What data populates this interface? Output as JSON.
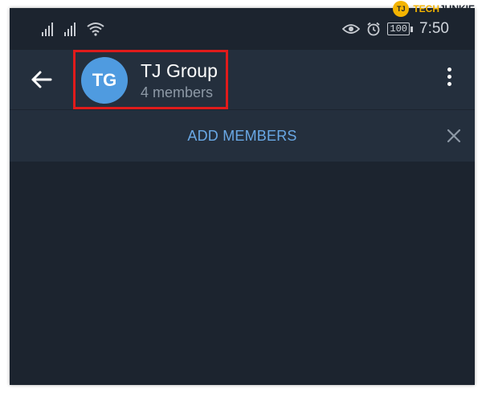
{
  "watermark": {
    "badge": "TJ",
    "brand_part1": "TECH",
    "brand_part2": "JUNKIE"
  },
  "statusbar": {
    "battery": "100",
    "time": "7:50"
  },
  "toolbar": {
    "avatar_initials": "TG",
    "title": "TJ Group",
    "subtitle": "4 members"
  },
  "actionbar": {
    "add_members_label": "ADD MEMBERS"
  },
  "colors": {
    "background": "#1c242f",
    "toolbar": "#242f3d",
    "avatar": "#4f9be0",
    "accent": "#69a8e5",
    "highlight": "#e01b1b",
    "brand": "#f4b400"
  }
}
